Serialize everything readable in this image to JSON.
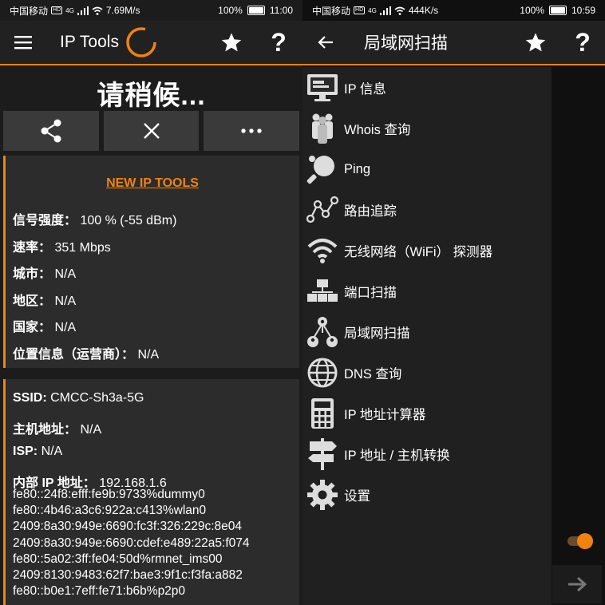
{
  "left": {
    "status": {
      "carrier": "中国移动",
      "hd": "HD",
      "net": "4G",
      "speed": "7.69M/s",
      "battery": "100%",
      "time": "11:00"
    },
    "appbar": {
      "title": "IP Tools"
    },
    "wait_title": "请稍候...",
    "card1": {
      "link": "NEW IP TOOLS",
      "rows": [
        {
          "label": "信号强度：",
          "value": "100 % (-55 dBm)"
        },
        {
          "label": "速率：",
          "value": "351 Mbps"
        },
        {
          "label": "城市：",
          "value": "N/A"
        },
        {
          "label": "地区：",
          "value": "N/A"
        },
        {
          "label": "国家：",
          "value": "N/A"
        },
        {
          "label": "位置信息（运营商）：",
          "value": "N/A"
        }
      ]
    },
    "card2": {
      "rows": [
        {
          "label": "SSID:",
          "value": "CMCC-Sh3a-5G"
        },
        {
          "label": "主机地址：",
          "value": "N/A"
        },
        {
          "label": "ISP:",
          "value": "N/A"
        },
        {
          "label": "内部 IP 地址：",
          "value": "192.168.1.6"
        }
      ],
      "ipv6": [
        "fe80::24f8:efff:fe9b:9733%dummy0",
        "fe80::4b46:a3c6:922a:c413%wlan0",
        "2409:8a30:949e:6690:fc3f:326:229c:8e04",
        "2409:8a30:949e:6690:cdef:e489:22a5:f074",
        "fe80::5a02:3ff:fe04:50d%rmnet_ims00",
        "2409:8130:9483:62f7:bae3:9f1c:f3fa:a882",
        "fe80::b0e1:7eff:fe71:b6b%p2p0"
      ]
    }
  },
  "right": {
    "status": {
      "carrier": "中国移动",
      "hd": "HD",
      "net": "4G",
      "speed": "444K/s",
      "battery": "100%",
      "time": "10:59"
    },
    "appbar": {
      "title": "局域网扫描"
    },
    "menu": [
      {
        "icon": "monitor-icon",
        "label": "IP 信息"
      },
      {
        "icon": "people-icon",
        "label": "Whois 查询"
      },
      {
        "icon": "ping-pong-icon",
        "label": "Ping"
      },
      {
        "icon": "route-icon",
        "label": "路由追踪"
      },
      {
        "icon": "wifi-icon",
        "label": "无线网络（WiFi） 探测器"
      },
      {
        "icon": "port-scan-icon",
        "label": "端口扫描"
      },
      {
        "icon": "lan-scan-icon",
        "label": "局域网扫描"
      },
      {
        "icon": "globe-icon",
        "label": "DNS 查询"
      },
      {
        "icon": "calculator-icon",
        "label": "IP 地址计算器"
      },
      {
        "icon": "signpost-icon",
        "label": "IP 地址 / 主机转换"
      },
      {
        "icon": "gear-icon",
        "label": "设置"
      }
    ]
  },
  "colors": {
    "accent": "#f0820f",
    "appbar": "#212121",
    "card": "#2c2c2c",
    "button": "#3a3a3a"
  }
}
